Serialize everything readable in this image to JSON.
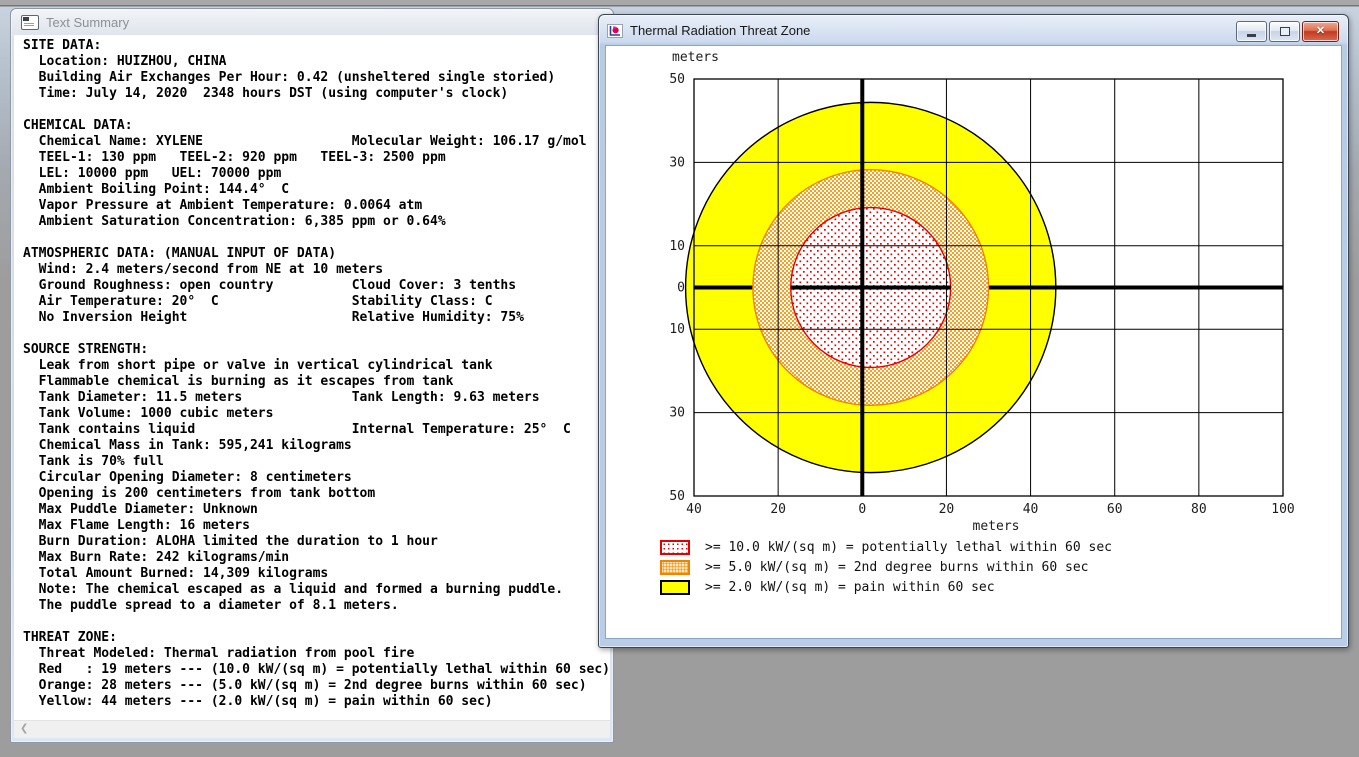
{
  "text_summary": {
    "title": "Text Summary",
    "icon": "document-icon",
    "scrollbar": {
      "left_arrow": "❮"
    },
    "lines": [
      "SITE DATA:",
      "  Location: HUIZHOU, CHINA",
      "  Building Air Exchanges Per Hour: 0.42 (unsheltered single storied)",
      "  Time: July 14, 2020  2348 hours DST (using computer's clock)",
      "",
      "CHEMICAL DATA:",
      "  Chemical Name: XYLENE                   Molecular Weight: 106.17 g/mol",
      "  TEEL-1: 130 ppm   TEEL-2: 920 ppm   TEEL-3: 2500 ppm",
      "  LEL: 10000 ppm   UEL: 70000 ppm",
      "  Ambient Boiling Point: 144.4°  C",
      "  Vapor Pressure at Ambient Temperature: 0.0064 atm",
      "  Ambient Saturation Concentration: 6,385 ppm or 0.64%",
      "",
      "ATMOSPHERIC DATA: (MANUAL INPUT OF DATA)",
      "  Wind: 2.4 meters/second from NE at 10 meters",
      "  Ground Roughness: open country          Cloud Cover: 3 tenths",
      "  Air Temperature: 20°  C                 Stability Class: C",
      "  No Inversion Height                     Relative Humidity: 75%",
      "",
      "SOURCE STRENGTH:",
      "  Leak from short pipe or valve in vertical cylindrical tank",
      "  Flammable chemical is burning as it escapes from tank",
      "  Tank Diameter: 11.5 meters              Tank Length: 9.63 meters",
      "  Tank Volume: 1000 cubic meters",
      "  Tank contains liquid                    Internal Temperature: 25°  C",
      "  Chemical Mass in Tank: 595,241 kilograms",
      "  Tank is 70% full",
      "  Circular Opening Diameter: 8 centimeters",
      "  Opening is 200 centimeters from tank bottom",
      "  Max Puddle Diameter: Unknown",
      "  Max Flame Length: 16 meters",
      "  Burn Duration: ALOHA limited the duration to 1 hour",
      "  Max Burn Rate: 242 kilograms/min",
      "  Total Amount Burned: 14,309 kilograms",
      "  Note: The chemical escaped as a liquid and formed a burning puddle.",
      "  The puddle spread to a diameter of 8.1 meters.",
      "",
      "THREAT ZONE:",
      "  Threat Modeled: Thermal radiation from pool fire",
      "  Red   : 19 meters --- (10.0 kW/(sq m) = potentially lethal within 60 sec)",
      "  Orange: 28 meters --- (5.0 kW/(sq m) = 2nd degree burns within 60 sec)",
      "  Yellow: 44 meters --- (2.0 kW/(sq m) = pain within 60 sec)"
    ]
  },
  "threat_zone_window": {
    "title": "Thermal Radiation Threat Zone",
    "icon": "threat-zone-plot-icon",
    "buttons": [
      "minimize",
      "restore",
      "close"
    ],
    "close_glyph": "✕"
  },
  "chart_data": {
    "type": "area",
    "subtype": "concentric-threat-zones",
    "title": "Thermal Radiation Threat Zone",
    "xlabel": "meters",
    "ylabel": "meters",
    "xlim": [
      -40,
      100
    ],
    "ylim": [
      -50,
      50
    ],
    "x_ticks": [
      -40,
      -20,
      0,
      20,
      40,
      60,
      80,
      100
    ],
    "x_tick_labels": [
      "40",
      "20",
      "0",
      "20",
      "40",
      "60",
      "80",
      "100"
    ],
    "y_ticks": [
      50,
      30,
      10,
      0,
      -10,
      -30,
      -50
    ],
    "y_tick_labels": [
      "50",
      "30",
      "10",
      "0",
      "10",
      "30",
      "50"
    ],
    "grid": true,
    "origin_crosshair": true,
    "center": [
      2,
      0
    ],
    "zones": [
      {
        "name": "yellow",
        "radius_m": 44,
        "threshold": ">= 2.0 kW/(sq m)",
        "effect": "pain within 60 sec",
        "color": "#ffff00",
        "outline": "#000000",
        "fill_style": "solid yellow"
      },
      {
        "name": "orange",
        "radius_m": 28,
        "threshold": ">= 5.0 kW/(sq m)",
        "effect": "2nd degree burns within 60 sec",
        "color": "#ff9c1a",
        "outline": "#f08300",
        "fill_style": "dense orange stipple on white"
      },
      {
        "name": "red",
        "radius_m": 19,
        "threshold": ">= 10.0 kW/(sq m)",
        "effect": "potentially lethal within 60 sec",
        "color": "#e40000",
        "outline": "#e40000",
        "fill_style": "sparse red dots on white"
      }
    ],
    "legend": [
      {
        "swatch": "red-dotted",
        "label": ">= 10.0 kW/(sq m) = potentially lethal within 60 sec"
      },
      {
        "swatch": "orange-stippled",
        "label": ">= 5.0 kW/(sq m) = 2nd degree burns within 60 sec"
      },
      {
        "swatch": "yellow-solid",
        "label": ">= 2.0 kW/(sq m) = pain within 60 sec"
      }
    ],
    "legend_position": "bottom-left"
  }
}
